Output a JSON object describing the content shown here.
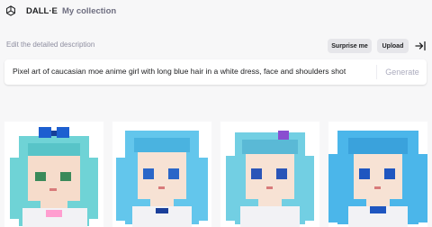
{
  "header": {
    "brand": "DALL·E",
    "nav_collection": "My collection"
  },
  "prompt": {
    "label": "Edit the detailed description",
    "text": "Pixel art of caucasian moe anime girl with long blue hair in a white dress, face and shoulders shot",
    "generate_label": "Generate"
  },
  "actions": {
    "surprise_label": "Surprise me",
    "upload_label": "Upload"
  },
  "icons": {
    "logo": "openai-logo-icon",
    "collapse": "collapse-right-icon"
  },
  "results": [
    {
      "hair": "#6fd3d6",
      "accent": "#1d5fd0"
    },
    {
      "hair": "#63c6ec",
      "accent": "#2a66c8"
    },
    {
      "hair": "#72cfe3",
      "accent": "#8a4dd0"
    },
    {
      "hair": "#4bb6ea",
      "accent": "#1f56c0"
    }
  ]
}
